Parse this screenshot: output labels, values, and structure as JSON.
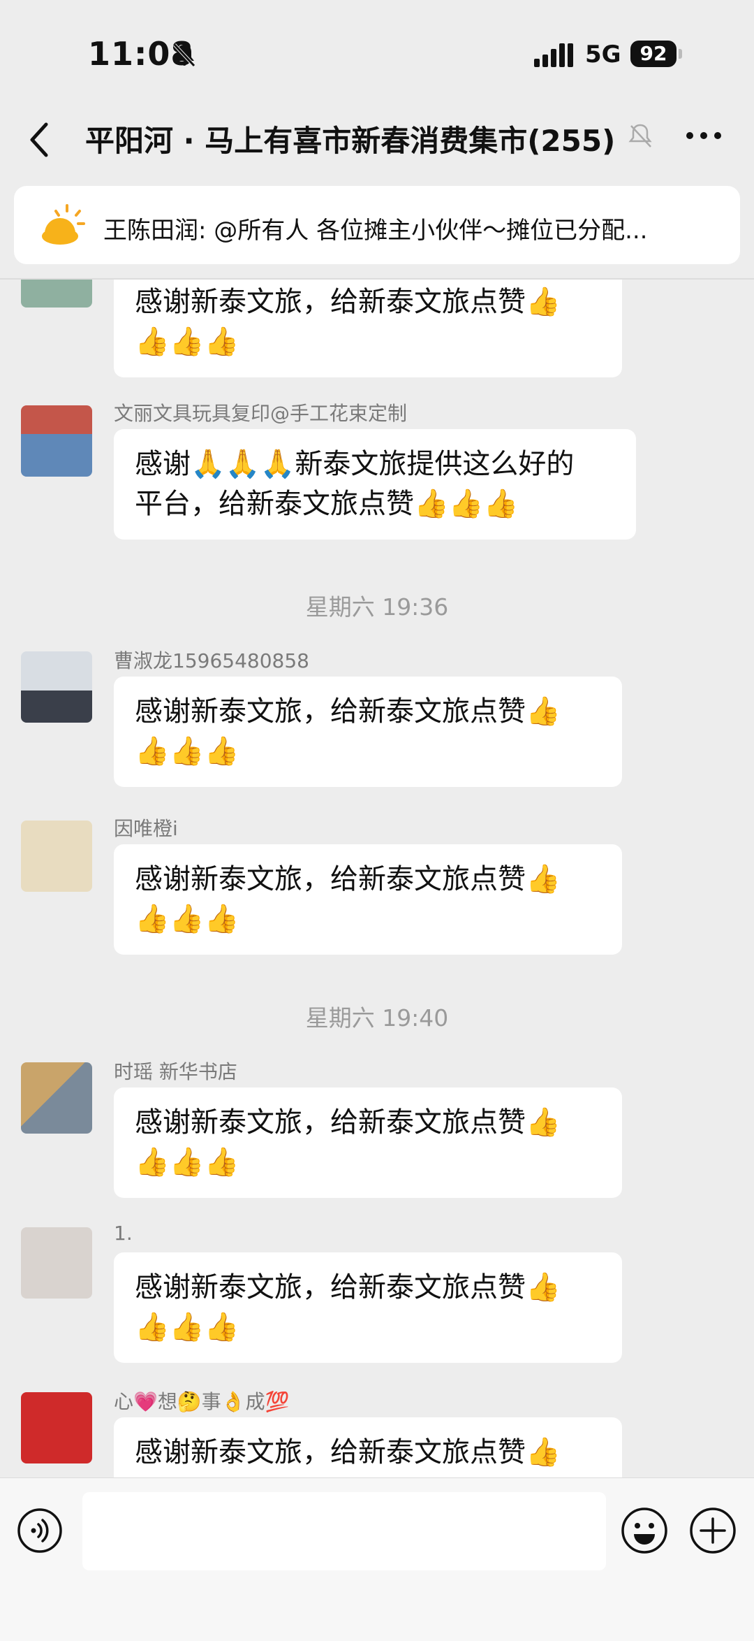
{
  "status_bar": {
    "time": "11:08",
    "network": "5G",
    "battery": "92"
  },
  "header": {
    "title": "平阳河 · 马上有喜市新春消费集市(255)"
  },
  "announcement": {
    "text": "王陈田润: @所有人 各位摊主小伙伴～摊位已分配..."
  },
  "timestamps": [
    "星期六 19:36",
    "星期六 19:40"
  ],
  "messages": [
    {
      "sender": "",
      "line1": "感谢新泰文旅，给新泰文旅点赞👍",
      "line2": "👍👍👍"
    },
    {
      "sender": "文丽文具玩具复印@手工花束定制",
      "line1": "感谢🙏🙏🙏新泰文旅提供这么好的",
      "line2": "平台，给新泰文旅点赞👍👍👍"
    },
    {
      "sender": "曹淑龙15965480858",
      "line1": "感谢新泰文旅，给新泰文旅点赞👍",
      "line2": "👍👍👍"
    },
    {
      "sender": "因唯橙i",
      "line1": "感谢新泰文旅，给新泰文旅点赞👍",
      "line2": "👍👍👍"
    },
    {
      "sender": "时瑶 新华书店",
      "line1": "感谢新泰文旅，给新泰文旅点赞👍",
      "line2": "👍👍👍"
    },
    {
      "sender": "1.",
      "line1": "感谢新泰文旅，给新泰文旅点赞👍",
      "line2": "👍👍👍"
    },
    {
      "sender": "心💗想🤔事👌成💯",
      "line1": "感谢新泰文旅，给新泰文旅点赞👍",
      "line2": ""
    }
  ],
  "avatar_colors": [
    "#8fb0a0",
    "#c4564a",
    "#b9c7d4",
    "#e8dcc0",
    "#7a8a9a",
    "#d9d3cf",
    "#cf2a2a"
  ]
}
